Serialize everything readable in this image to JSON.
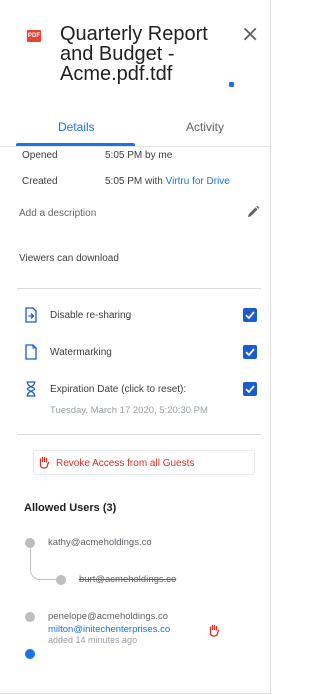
{
  "header": {
    "file_icon": "pdf-icon",
    "file_icon_text": "PDF",
    "title": "Quarterly Report and Budget - Acme.pdf.tdf",
    "close_icon": "close-icon",
    "close_glyph": "×"
  },
  "tabs": [
    {
      "label": "Details",
      "active": true
    },
    {
      "label": "Activity",
      "active": false
    }
  ],
  "details": {
    "opened_label": "Opened",
    "opened_value": "5:05 PM by me",
    "created_label": "Created",
    "created_value": "5:05 PM with ",
    "created_link": "Virtru for Drive",
    "description_placeholder": "Add a description",
    "edit_icon": "pencil-icon",
    "viewers_text": "Viewers can download"
  },
  "options": [
    {
      "icon": "share-arrow-icon",
      "label": "Disable re-sharing",
      "checked": true
    },
    {
      "icon": "watermark-doc-icon",
      "label": "Watermarking",
      "checked": true
    },
    {
      "icon": "hourglass-icon",
      "label": "Expiration Date (click to reset):",
      "checked": true
    }
  ],
  "expiration_date": "Tuesday, March 17 2020, 5:20:30 PM",
  "revoke": {
    "icon": "hand-icon",
    "label": "Revoke Access from all Guests"
  },
  "allowed_users": {
    "heading": "Allowed Users (3)",
    "users": [
      {
        "email": "kathy@acmeholdings.co",
        "revoked": false
      },
      {
        "email": "burt@acmeholdings.co",
        "revoked": true
      },
      {
        "email": "penelope@acmeholdings.co",
        "revoked": false
      },
      {
        "email": "milton@initechenterprises.co",
        "revoked": false,
        "note": "added 14 minutes ago"
      }
    ]
  },
  "colors": {
    "accent": "#1a73e8",
    "checkbox": "#1a5bd1",
    "danger": "#d93025",
    "pdf_red": "#ea4335"
  }
}
